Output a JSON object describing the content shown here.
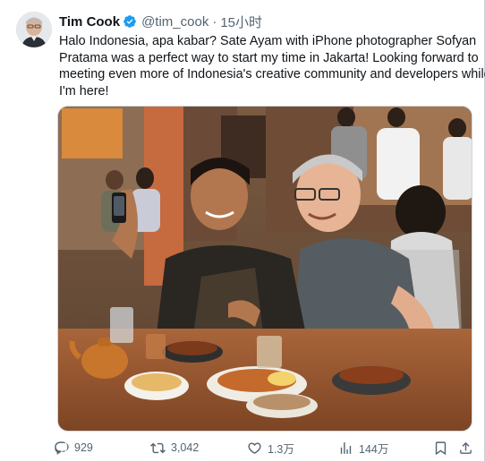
{
  "tweet": {
    "author_name": "Tim Cook",
    "handle": "@tim_cook",
    "separator": "·",
    "time": "15小时",
    "text_lines": [
      "Halo Indonesia, apa kabar? Sate Ayam with iPhone photographer Sofyan",
      "Pratama was a perfect way to start my time in Jakarta! Looking forward to",
      "meeting even more of Indonesia's creative community and developers while",
      "I'm here!"
    ],
    "verified_color": "#1d9bf0"
  },
  "actions": {
    "reply_count": "929",
    "retweet_count": "3,042",
    "like_count": "1.3万",
    "views_count": "144万"
  },
  "icons": {
    "verified": "verified-badge-icon",
    "reply": "reply-icon",
    "retweet": "retweet-icon",
    "like": "heart-icon",
    "views": "views-chart-icon",
    "bookmark": "bookmark-icon",
    "share": "share-icon"
  },
  "colors": {
    "text_primary": "#0f1419",
    "text_secondary": "#536471",
    "accent": "#1d9bf0"
  }
}
